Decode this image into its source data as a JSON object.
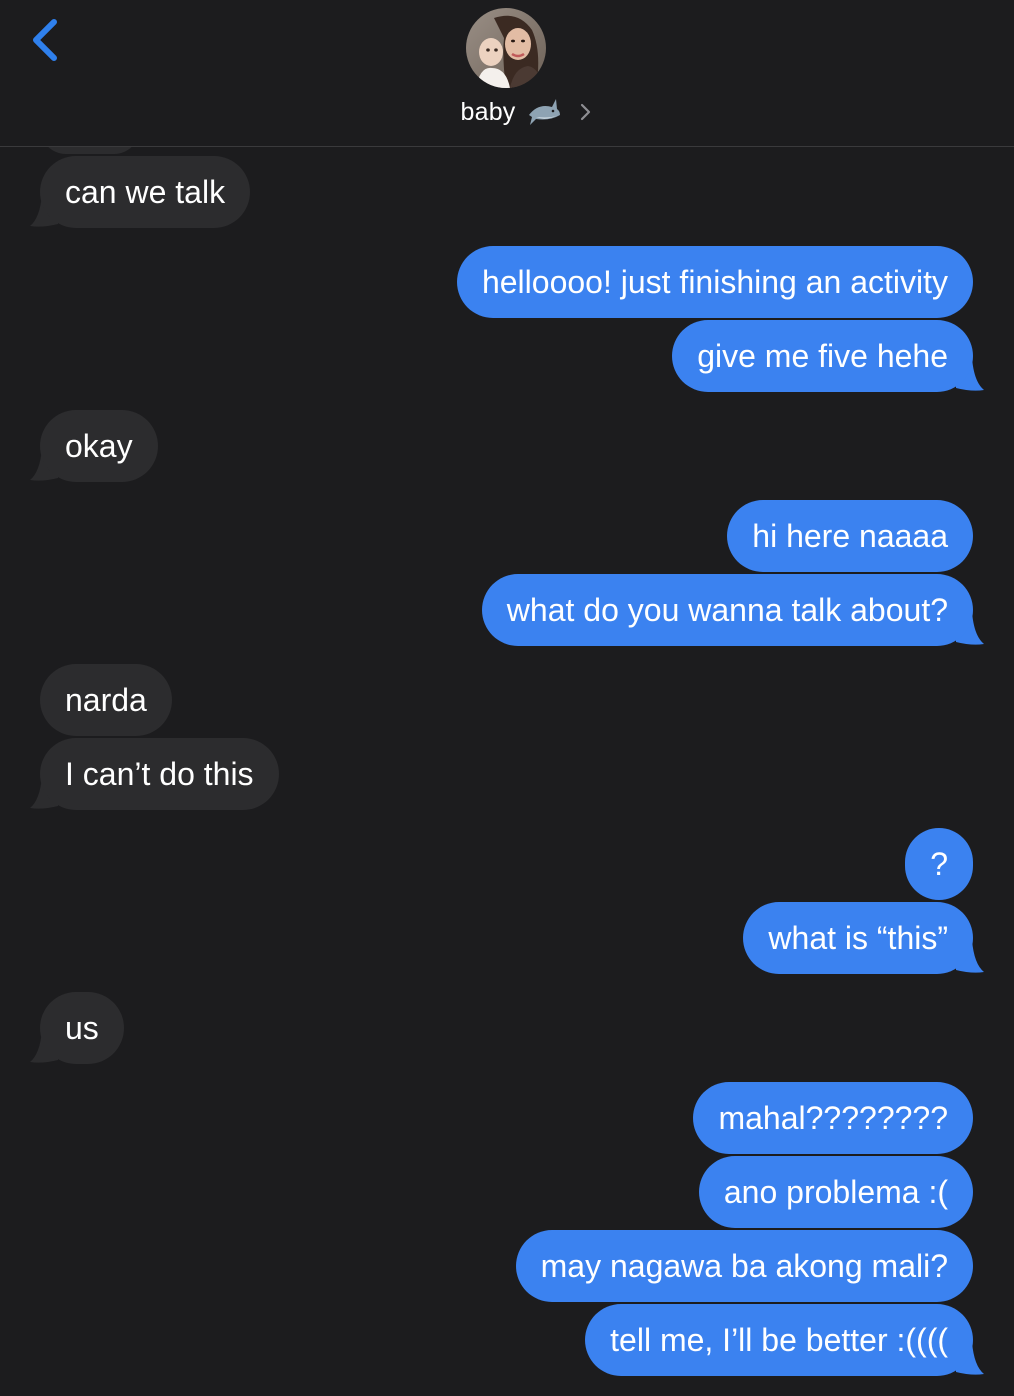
{
  "header": {
    "contact_name": "baby",
    "back_icon": "chevron-left-icon",
    "avatar_icon": "contact-avatar",
    "emoji_icon": "shark-emoji-icon",
    "chevron_icon": "chevron-right-icon",
    "accent_color": "#2f80ed"
  },
  "colors": {
    "background": "#1c1c1e",
    "outgoing_bubble": "#3b82f0",
    "incoming_bubble": "#2c2c2e",
    "text": "#ffffff"
  },
  "messages": [
    {
      "from": "them",
      "text": "can we talk"
    },
    {
      "from": "me",
      "text": "helloooo! just finishing an activity"
    },
    {
      "from": "me",
      "text": "give me five hehe"
    },
    {
      "from": "them",
      "text": "okay"
    },
    {
      "from": "me",
      "text": "hi here naaaa"
    },
    {
      "from": "me",
      "text": "what do you wanna talk about?"
    },
    {
      "from": "them",
      "text": "narda"
    },
    {
      "from": "them",
      "text": "I can’t do this"
    },
    {
      "from": "me",
      "text": "?"
    },
    {
      "from": "me",
      "text": "what is “this”"
    },
    {
      "from": "them",
      "text": "us"
    },
    {
      "from": "me",
      "text": "mahal????????"
    },
    {
      "from": "me",
      "text": "ano problema :("
    },
    {
      "from": "me",
      "text": "may nagawa ba akong mali?"
    },
    {
      "from": "me",
      "text": "tell me, I’ll be better :(((("
    }
  ]
}
